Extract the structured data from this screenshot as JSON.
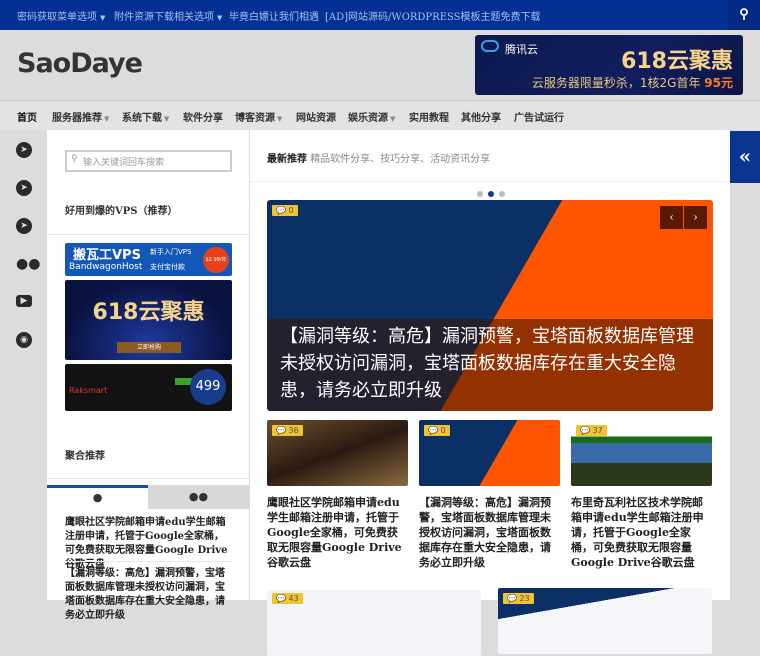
{
  "topbar": {
    "items": [
      "密码获取菜单选项",
      "附件资源下载相关选项",
      "毕竟白嫖让我们相遇",
      "[AD]网站源码/WORDPRESS模板主题免费下载"
    ]
  },
  "header": {
    "logo": "SaoDaye",
    "banner": {
      "brand": "腾讯云",
      "title": "618云聚惠",
      "subtitle": "云服务器限量秒杀，1核2G首年 ",
      "price": "95元"
    }
  },
  "nav": [
    "首页",
    "服务器推荐",
    "系统下载",
    "软件分享",
    "博客资源",
    "网站资源",
    "娱乐资源",
    "实用教程",
    "其他分享",
    "广告试运行"
  ],
  "sidebar": {
    "search_placeholder": "输入关键词回车搜索",
    "vps_heading": "好用到爆的VPS（推荐）",
    "ads": {
      "a1_title": "搬瓦工VPS",
      "a1_sub": "BandwagonHost",
      "a1_tag": "新手入门VPS",
      "a1_tag2": "支付宝付款",
      "a1_price": "$2.99/年",
      "a2_title": "618云聚惠",
      "a2_btn": "立即抢购",
      "a3_brand": "Raksmart",
      "a3_price": "499"
    },
    "agg_heading": "聚合推荐",
    "posts": [
      "鹰眼社区学院邮箱申请edu学生邮箱注册申请，托管于Google全家桶，可免费获取无限容量Google Drive谷歌云盘",
      "【漏洞等级：高危】漏洞预警，宝塔面板数据库管理未授权访问漏洞，宝塔面板数据库存在重大安全隐患，请务必立即升级"
    ]
  },
  "main": {
    "heading": "最新推荐",
    "subheading": "精品软件分享、技巧分享、活动资讯分享",
    "slider": {
      "comments": "0",
      "caption": "【漏洞等级：高危】漏洞预警，宝塔面板数据库管理未授权访问漏洞，宝塔面板数据库存在重大安全隐患，请务必立即升级"
    },
    "cards": [
      {
        "comments": "36",
        "title": "鹰眼社区学院邮箱申请edu学生邮箱注册申请，托管于Google全家桶，可免费获取无限容量Google Drive谷歌云盘"
      },
      {
        "comments": "0",
        "title": "【漏洞等级：高危】漏洞预警，宝塔面板数据库管理未授权访问漏洞，宝塔面板数据库存在重大安全隐患，请务必立即升级"
      },
      {
        "comments": "37",
        "title": "布里奇瓦利社区技术学院邮箱申请edu学生邮箱注册申请，托管于Google全家桶，可免费获取无限容量Google Drive谷歌云盘"
      }
    ],
    "more_comments": [
      "43",
      "23"
    ]
  }
}
